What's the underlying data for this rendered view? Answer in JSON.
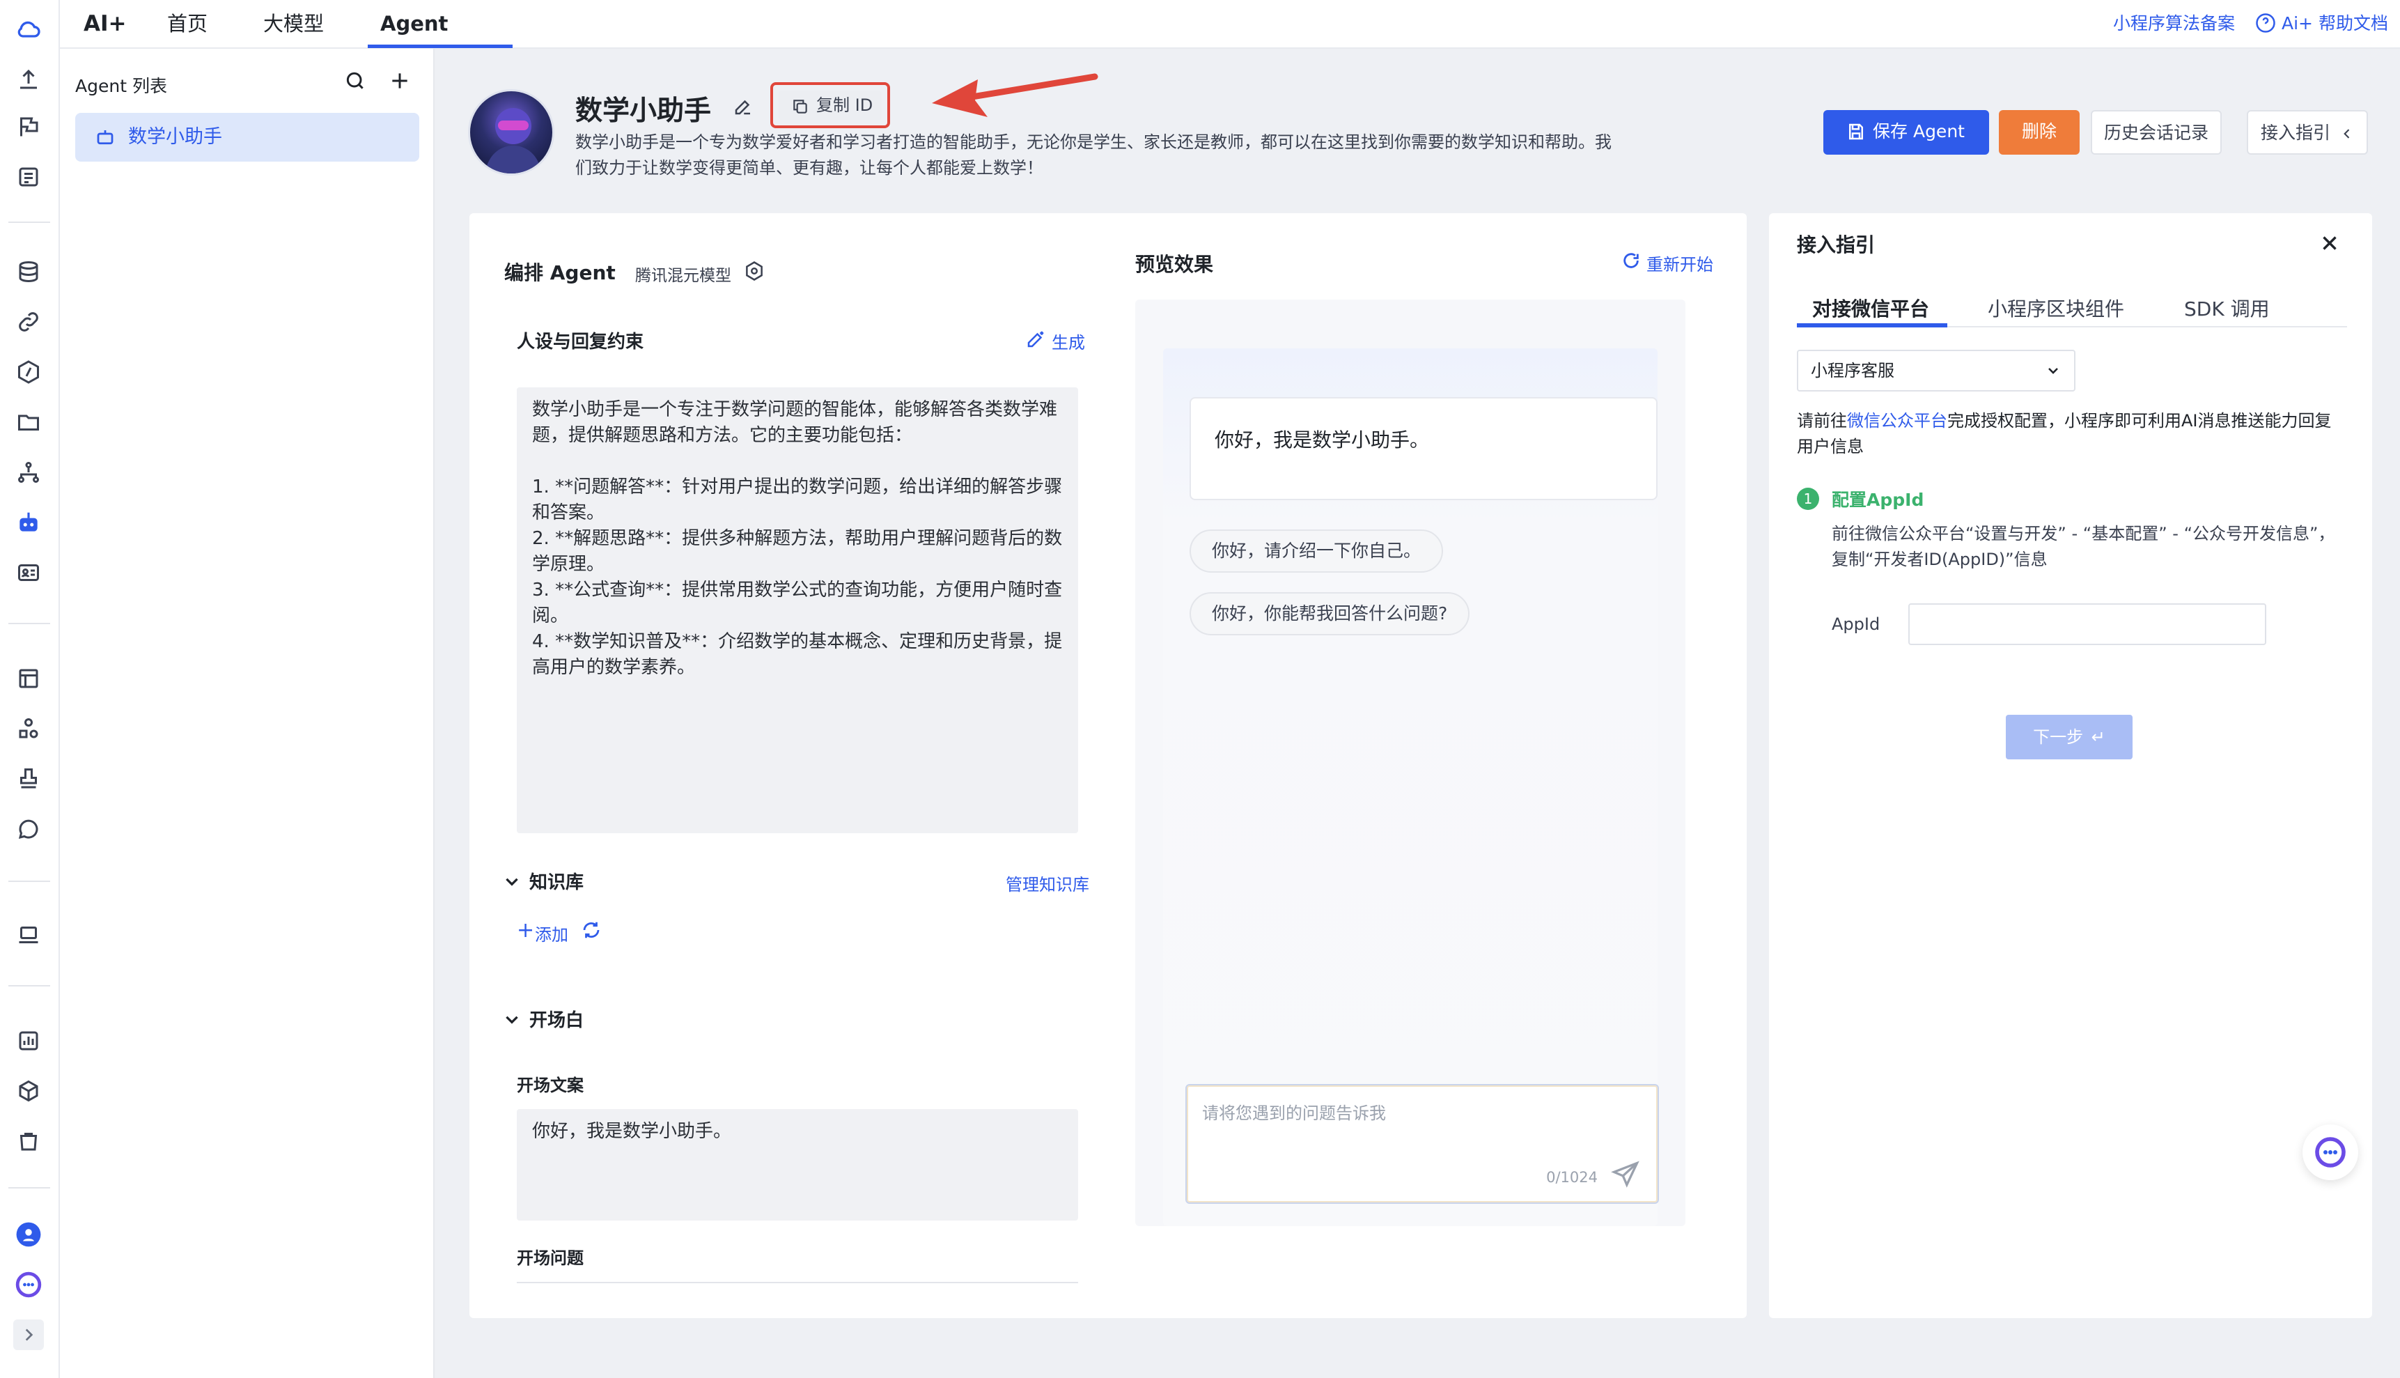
{
  "topbar": {
    "brand": "AI+",
    "nav": [
      "首页",
      "大模型",
      "Agent"
    ],
    "links": [
      "小程序算法备案",
      "Ai+ 帮助文档"
    ]
  },
  "agent_list": {
    "title": "Agent 列表",
    "items": [
      "数学小助手"
    ]
  },
  "agent": {
    "name": "数学小助手",
    "copy_id_label": "复制 ID",
    "description": "数学小助手是一个专为数学爱好者和学习者打造的智能助手，无论你是学生、家长还是教师，都可以在这里找到你需要的数学知识和帮助。我们致力于让数学变得更简单、更有趣，让每个人都能爱上数学！"
  },
  "actions": {
    "save": "保存 Agent",
    "delete": "删除",
    "history": "历史会话记录",
    "guide": "接入指引"
  },
  "editor": {
    "title": "编排 Agent",
    "model": "腾讯混元模型",
    "persona_title": "人设与回复约束",
    "generate": "生成",
    "persona_text": "数学小助手是一个专注于数学问题的智能体，能够解答各类数学难题，提供解题思路和方法。它的主要功能包括：\n\n1. **问题解答**：针对用户提出的数学问题，给出详细的解答步骤和答案。\n2. **解题思路**：提供多种解题方法，帮助用户理解问题背后的数学原理。\n3. **公式查询**：提供常用数学公式的查询功能，方便用户随时查阅。\n4. **数学知识普及**：介绍数学的基本概念、定理和历史背景，提高用户的数学素养。",
    "knowledge_title": "知识库",
    "manage_knowledge": "管理知识库",
    "add": "添加",
    "opening_title": "开场白",
    "opening_text_label": "开场文案",
    "opening_text": "你好，我是数学小助手。",
    "opening_questions_label": "开场问题"
  },
  "preview": {
    "title": "预览效果",
    "restart": "重新开始",
    "greeting": "你好，我是数学小助手。",
    "suggestions": [
      "你好，请介绍一下你自己。",
      "你好，你能帮我回答什么问题?"
    ],
    "input_placeholder": "请将您遇到的问题告诉我",
    "counter": "0/1024"
  },
  "guide": {
    "title": "接入指引",
    "tabs": [
      "对接微信平台",
      "小程序区块组件",
      "SDK 调用"
    ],
    "select_value": "小程序客服",
    "intro_prefix": "请前往",
    "intro_link": "微信公众平台",
    "intro_suffix": "完成授权配置，小程序即可利用AI消息推送能力回复用户信息",
    "step_number": "1",
    "step_title": "配置AppId",
    "step_desc": "前往微信公众平台“设置与开发” - “基本配置” - “公众号开发信息”，复制“开发者ID(AppID)”信息",
    "appid_label": "AppId",
    "next": "下一步"
  },
  "colors": {
    "primary": "#2f5bea",
    "danger": "#ef7c3a",
    "success": "#3bb26d",
    "highlight": "#e0463a"
  }
}
